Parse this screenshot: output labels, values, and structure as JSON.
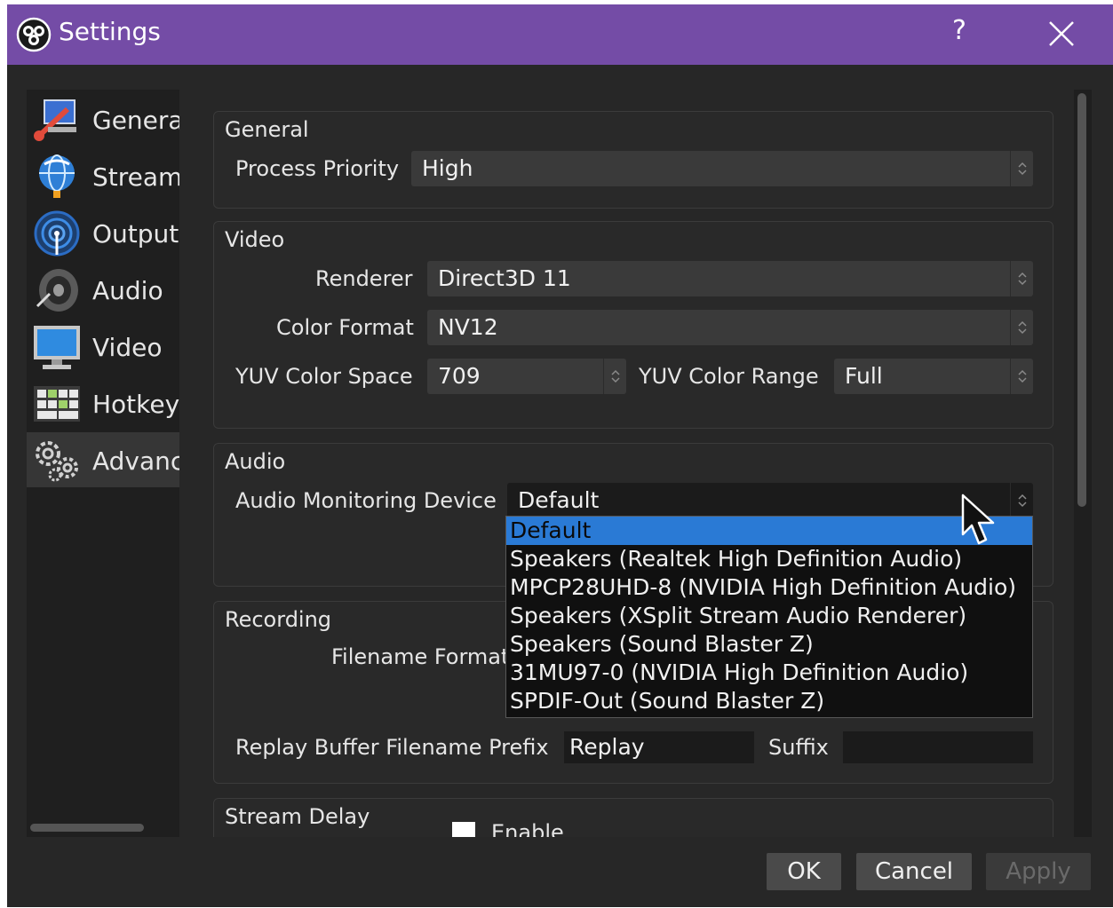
{
  "window": {
    "title": "Settings",
    "help_label": "?",
    "titlebar_color": "#744ca6"
  },
  "sidebar": {
    "items": [
      {
        "label": "Genera",
        "icon": "general-icon"
      },
      {
        "label": "Stream",
        "icon": "stream-globe-icon"
      },
      {
        "label": "Output",
        "icon": "output-broadcast-icon"
      },
      {
        "label": "Audio",
        "icon": "speaker-icon"
      },
      {
        "label": "Video",
        "icon": "monitor-icon"
      },
      {
        "label": "Hotkey",
        "icon": "keyboard-icon"
      },
      {
        "label": "Advanc",
        "icon": "gears-icon",
        "active": true
      }
    ]
  },
  "general": {
    "title": "General",
    "process_priority_label": "Process Priority",
    "process_priority_value": "High"
  },
  "video": {
    "title": "Video",
    "renderer_label": "Renderer",
    "renderer_value": "Direct3D 11",
    "color_format_label": "Color Format",
    "color_format_value": "NV12",
    "yuv_space_label": "YUV Color Space",
    "yuv_space_value": "709",
    "yuv_range_label": "YUV Color Range",
    "yuv_range_value": "Full"
  },
  "audio": {
    "title": "Audio",
    "monitoring_label": "Audio Monitoring Device",
    "monitoring_value": "Default",
    "options": [
      "Default",
      "Speakers (Realtek High Definition Audio)",
      "MPCP28UHD-8 (NVIDIA High Definition Audio)",
      "Speakers (XSplit  Stream  Audio  Renderer)",
      "Speakers (Sound Blaster Z)",
      "31MU97-0 (NVIDIA High Definition Audio)",
      "SPDIF-Out (Sound Blaster Z)"
    ],
    "selected_index": 0,
    "highlight_color": "#2a7ad5"
  },
  "recording": {
    "title": "Recording",
    "filename_format_label": "Filename Format",
    "replay_prefix_label": "Replay Buffer Filename Prefix",
    "replay_prefix_value": "Replay",
    "suffix_label": "Suffix",
    "suffix_value": ""
  },
  "stream_delay": {
    "title": "Stream Delay",
    "enable_label": "Enable",
    "enable_checked": false
  },
  "buttons": {
    "ok": "OK",
    "cancel": "Cancel",
    "apply": "Apply"
  }
}
